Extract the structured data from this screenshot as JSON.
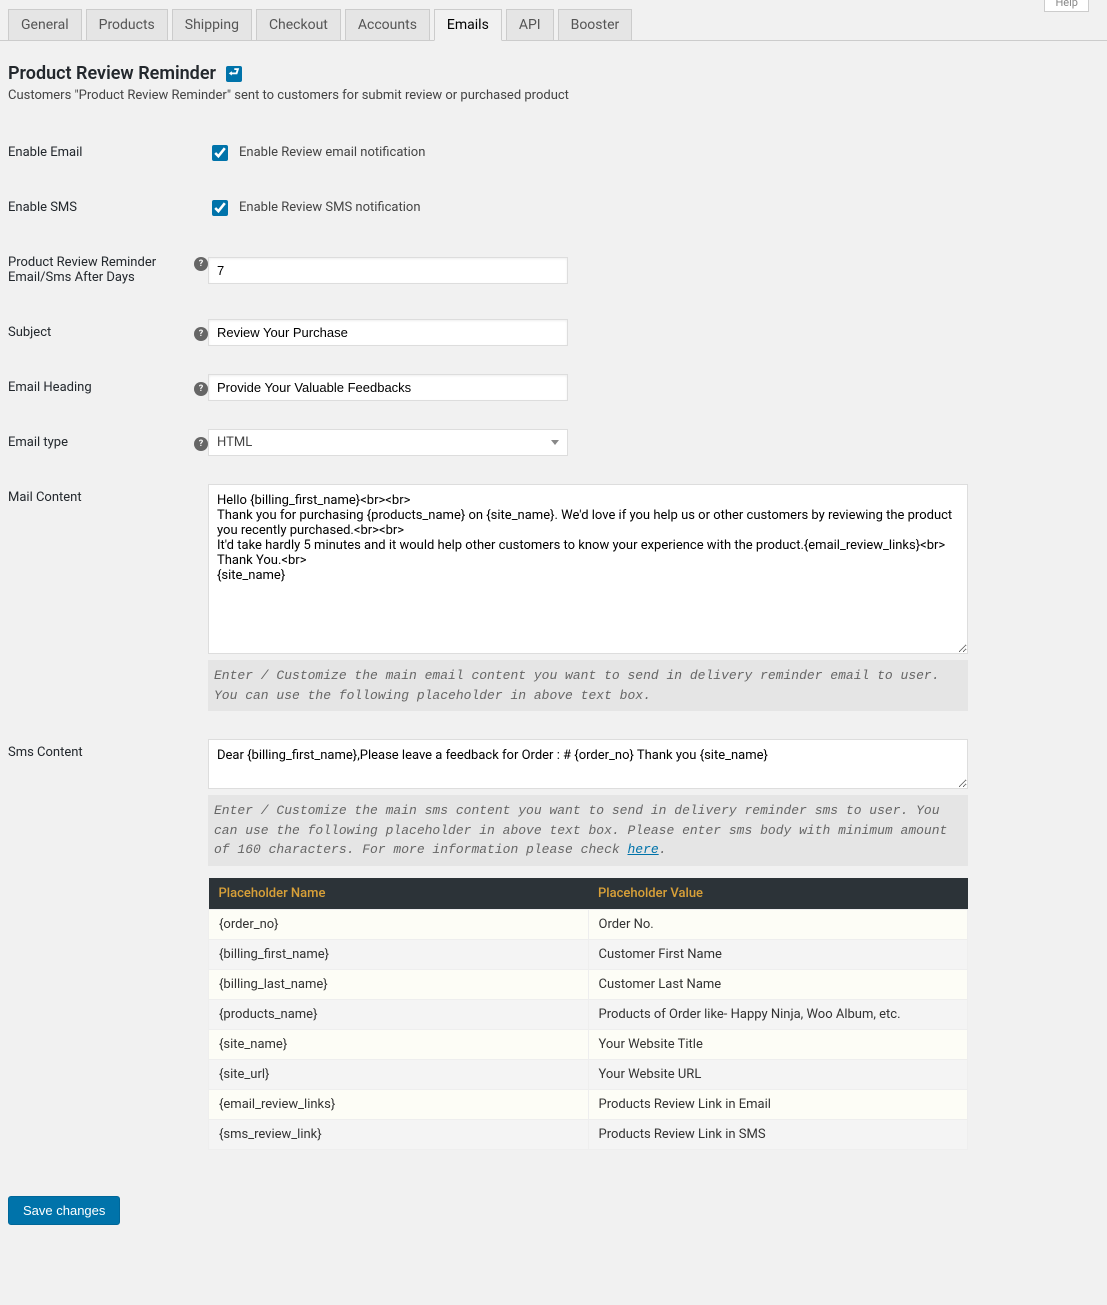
{
  "top_help": "Help",
  "tabs": [
    {
      "label": "General"
    },
    {
      "label": "Products"
    },
    {
      "label": "Shipping"
    },
    {
      "label": "Checkout"
    },
    {
      "label": "Accounts"
    },
    {
      "label": "Emails",
      "active": true
    },
    {
      "label": "API"
    },
    {
      "label": "Booster"
    }
  ],
  "section": {
    "title": "Product Review Reminder",
    "desc": "Customers \"Product Review Reminder\" sent to customers for submit review or purchased product"
  },
  "form": {
    "enable_email": {
      "label": "Enable Email",
      "checkbox_label": "Enable Review email notification",
      "checked": true
    },
    "enable_sms": {
      "label": "Enable SMS",
      "checkbox_label": "Enable Review SMS notification",
      "checked": true
    },
    "days": {
      "label": "Product Review Reminder Email/Sms After Days",
      "value": "7"
    },
    "subject": {
      "label": "Subject",
      "value": "Review Your Purchase"
    },
    "heading": {
      "label": "Email Heading",
      "value": "Provide Your Valuable Feedbacks"
    },
    "email_type": {
      "label": "Email type",
      "value": "HTML"
    },
    "mail_content": {
      "label": "Mail Content",
      "value": "Hello {billing_first_name}<br><br>\nThank you for purchasing {products_name} on {site_name}. We'd love if you help us or other customers by reviewing the product you recently purchased.<br><br>\nIt'd take hardly 5 minutes and it would help other customers to know your experience with the product.{email_review_links}<br>\nThank You.<br>\n{site_name}",
      "hint": "Enter / Customize the main email content you want to send in delivery reminder email to user. You can use the following placeholder in above text box."
    },
    "sms_content": {
      "label": "Sms Content",
      "value": "Dear {billing_first_name},Please leave a feedback for Order : # {order_no} Thank you {site_name}",
      "hint_pre": "Enter / Customize the main sms content you want to send in delivery reminder sms to user. You can use the following placeholder in above text box. Please enter sms body with minimum amount of 160 characters. For more information please check ",
      "hint_link": "here",
      "hint_post": "."
    }
  },
  "placeholders": {
    "head_name": "Placeholder Name",
    "head_value": "Placeholder Value",
    "rows": [
      {
        "name": "{order_no}",
        "value": "Order No."
      },
      {
        "name": "{billing_first_name}",
        "value": "Customer First Name"
      },
      {
        "name": "{billing_last_name}",
        "value": "Customer Last Name"
      },
      {
        "name": "{products_name}",
        "value": "Products of Order like- Happy Ninja, Woo Album, etc."
      },
      {
        "name": "{site_name}",
        "value": "Your Website Title"
      },
      {
        "name": "{site_url}",
        "value": "Your Website URL"
      },
      {
        "name": "{email_review_links}",
        "value": "Products Review Link in Email"
      },
      {
        "name": "{sms_review_link}",
        "value": "Products Review Link in SMS"
      }
    ]
  },
  "save_label": "Save changes"
}
